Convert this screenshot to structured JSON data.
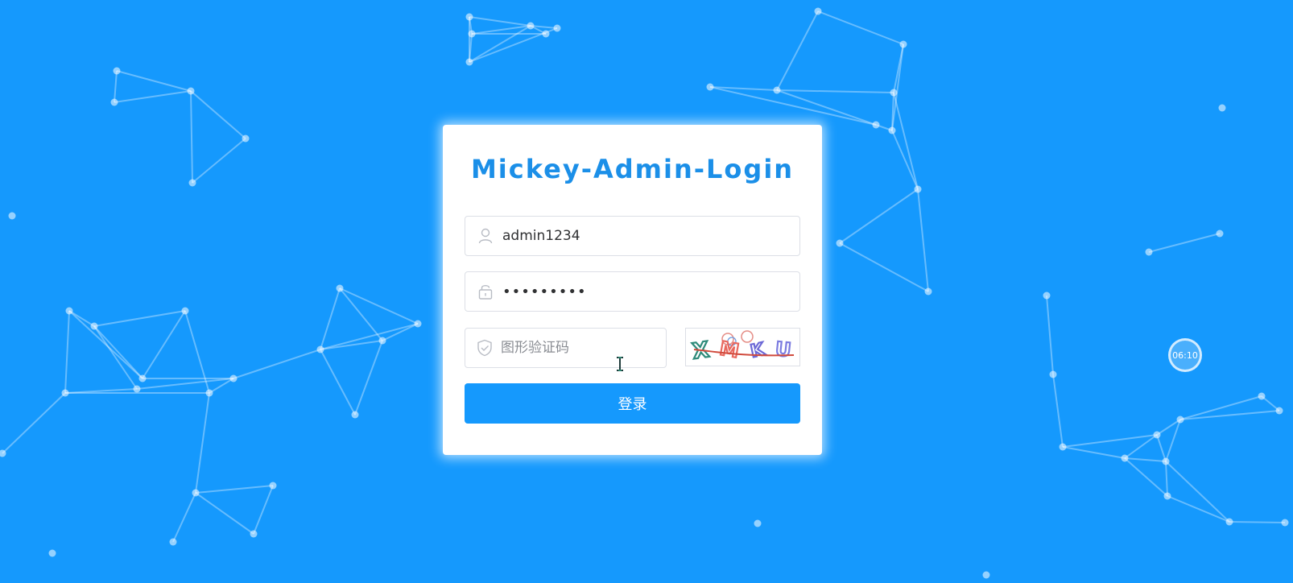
{
  "login": {
    "title": "Mickey-Admin-Login",
    "username": {
      "icon": "user-icon",
      "value": "admin1234",
      "placeholder": ""
    },
    "password": {
      "icon": "lock-icon",
      "value": "123456789",
      "placeholder": ""
    },
    "captcha": {
      "icon": "shield-check-icon",
      "value": "",
      "placeholder": "图形验证码",
      "image_text": "XMKU",
      "image_colors": [
        "#2e8b7a",
        "#e8685e",
        "#6c68d6",
        "#7c7ce0"
      ],
      "strike_color": "#d04a3c"
    },
    "submit_label": "登录"
  },
  "clock_badge": "06:10",
  "theme": {
    "background": "#1599fd",
    "title_color": "#1b8fe8",
    "button_color": "#1599fd"
  }
}
